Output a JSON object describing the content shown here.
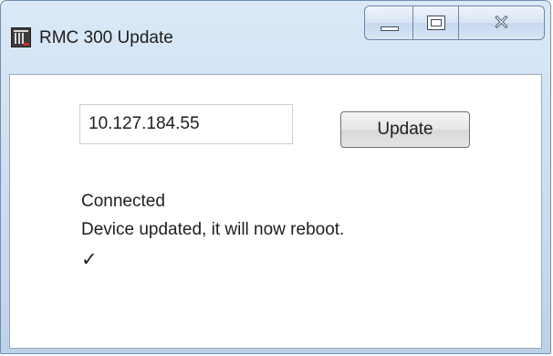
{
  "window": {
    "title": "RMC 300 Update",
    "caption_buttons": {
      "minimize": "minimize",
      "maximize": "maximize",
      "close": "close"
    },
    "close_glyph": "✕"
  },
  "form": {
    "ip_address_value": "10.127.184.55",
    "update_button_label": "Update"
  },
  "status": {
    "connection": "Connected",
    "message": "Device updated, it will now reboot.",
    "check": "✓"
  },
  "icons": {
    "app": "rmc-app-icon",
    "minimize": "minimize-icon",
    "maximize": "maximize-icon",
    "close": "close-icon",
    "check": "checkmark-icon"
  },
  "colors": {
    "titlebar": "#c9dcf0",
    "border": "#6f8fb0",
    "client_background": "#ffffff",
    "text": "#1e1e1e"
  }
}
